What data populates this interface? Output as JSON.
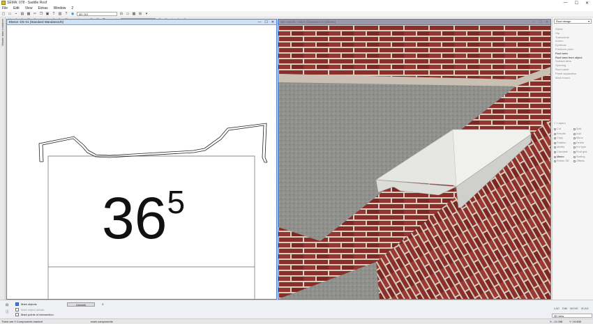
{
  "window": {
    "title": "SEMA: 078 - Saddle Roof",
    "controls": [
      "—",
      "☐",
      "✕"
    ]
  },
  "menu": [
    "File",
    "Edit",
    "View",
    "Extras",
    "Window",
    "2"
  ],
  "toolbar": {
    "layer_select": "3D: DG",
    "setting_select": "00 Start setting"
  },
  "left_tab": "Master data container",
  "plan_window": {
    "title": "Ebene: DG 01 (Standard Wandansicht)",
    "dimension_main": "36",
    "dimension_sup": "5"
  },
  "view3d_window": {
    "title": "3D Ansicht - Dach (Standard Ansichten)"
  },
  "right_panel": {
    "select": "Roof design",
    "items": [
      {
        "label": "Gable",
        "active": false
      },
      {
        "label": "Hip",
        "active": false
      },
      {
        "label": "Transverse",
        "active": false
      },
      {
        "label": "Annex",
        "active": false
      },
      {
        "label": "Eyebrow",
        "active": false
      },
      {
        "label": "Freeform pitch",
        "active": false
      },
      {
        "label": "Roof area",
        "active": true
      },
      {
        "label": "Roof area from object",
        "active": true
      },
      {
        "label": "Surface area",
        "active": false
      },
      {
        "label": "Opening",
        "active": false
      },
      {
        "label": "Roof panel",
        "active": false
      },
      {
        "label": "Panel separation",
        "active": false
      },
      {
        "label": "Mark macro",
        "active": false
      }
    ],
    "layers_label": "Layers",
    "ops": [
      {
        "label": "Cut",
        "active": false
      },
      {
        "label": "Split",
        "active": false
      },
      {
        "label": "Results",
        "active": false
      },
      {
        "label": "Add",
        "active": false
      },
      {
        "label": "Copy",
        "active": false
      },
      {
        "label": "Mirror",
        "active": false
      },
      {
        "label": "Position",
        "active": false
      },
      {
        "label": "Delete",
        "active": false
      },
      {
        "label": "Modify",
        "active": false
      },
      {
        "label": "Knt type",
        "active": false
      },
      {
        "label": "Calculate",
        "active": false
      },
      {
        "label": "Roof grid",
        "active": false
      },
      {
        "label": "Macro",
        "active": true
      },
      {
        "label": "Scaling",
        "active": false
      },
      {
        "label": "Return 3D",
        "active": false
      },
      {
        "label": "Offsets",
        "active": false
      }
    ]
  },
  "bottom": {
    "mark_objects": "Mark objects",
    "mark_object_details": "Mark object details",
    "mark_points": "Mark points of intersection",
    "unmark_button": "Unmark",
    "tabs": [
      "LAD",
      "DIM",
      "MOVE",
      "3CAD"
    ],
    "view_select": "3D view"
  },
  "status": {
    "left": "There are 0 Components marked",
    "middle": "mark components",
    "coord_x": "X: -11.098",
    "coord_y": "Y: 19.608"
  }
}
